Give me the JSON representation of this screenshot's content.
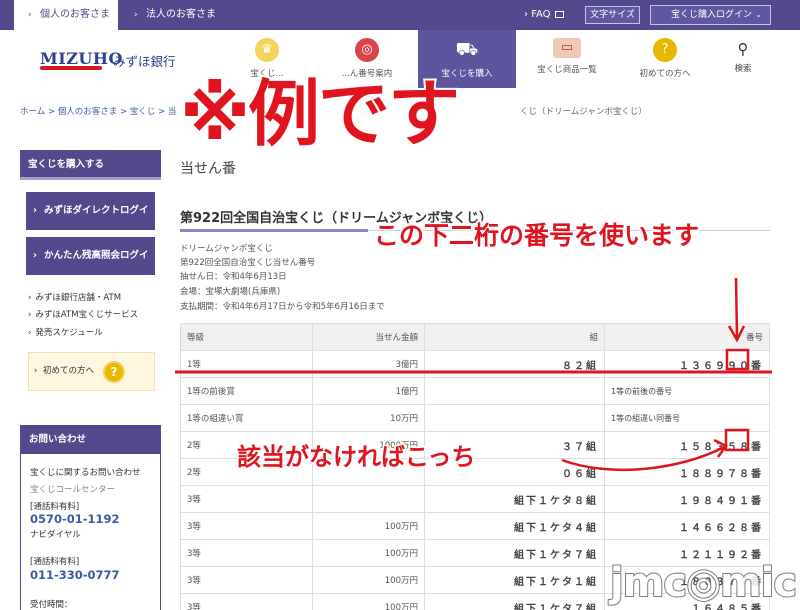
{
  "topbar": {
    "tab_personal": "個人のお客さま",
    "tab_corporate": "法人のお客さま",
    "faq": "FAQ",
    "text_size": "文字サイズ",
    "login": "宝くじ購入ログイン"
  },
  "header": {
    "logo": "MIZUHO",
    "bank_name": "みずほ銀行",
    "nav": [
      {
        "label": "宝くじ..."
      },
      {
        "label": "...ん番号案内"
      },
      {
        "label": "宝くじを購入"
      },
      {
        "label": "宝くじ商品一覧"
      },
      {
        "label": "初めての方へ"
      }
    ],
    "search": "検索"
  },
  "breadcrumb": {
    "left": "ホーム > 個人のお客さま > 宝くじ > 当",
    "right": "くじ（ドリームジャンボ宝くじ）"
  },
  "sidebar": {
    "heading": "宝くじを購入する",
    "btn_direct": "みずほダイレクトログイン",
    "btn_balance": "かんたん残高照会ログイン",
    "links": [
      "みずほ銀行店舗・ATM",
      "みずほATM宝くじサービス",
      "発売スケジュール"
    ],
    "guide": "初めての方へ",
    "contact": {
      "heading": "お問い合わせ",
      "label": "宝くじに関するお問い合わせ",
      "center": "宝くじコールセンター",
      "toll1": "[通話料有料]",
      "phone1": "0570-01-1192",
      "navi": "ナビダイヤル",
      "toll2": "[通話料有料]",
      "phone2": "011-330-0777",
      "hours": "受付時間："
    }
  },
  "main": {
    "page_heading": "当せん番",
    "lottery_title": "第922回全国自治宝くじ（ドリームジャンボ宝くじ）",
    "info": [
      "ドリームジャンボ宝くじ",
      "第922回全国自治宝くじ当せん番号",
      "抽せん日：令和4年6月13日",
      "会場：宝塚大劇場(兵庫県)",
      "支払期間：令和4年6月17日から令和5年6月16日まで"
    ],
    "table": {
      "headers": [
        "等級",
        "当せん金額",
        "組",
        "番号"
      ],
      "rows": [
        {
          "grade": "1等",
          "amount": "3億円",
          "group": "８２組",
          "number": "１３６９９０番"
        },
        {
          "grade": "1等の前後賞",
          "amount": "1億円",
          "group": "",
          "number": "1等の前後の番号"
        },
        {
          "grade": "1等の組違い賞",
          "amount": "10万円",
          "group": "",
          "number": "1等の組違い同番号"
        },
        {
          "grade": "2等",
          "amount": "1000万円",
          "group": "３７組",
          "number": "１５８３５８番"
        },
        {
          "grade": "2等",
          "amount": "",
          "group": "０６組",
          "number": "１８８９７８番"
        },
        {
          "grade": "3等",
          "amount": "",
          "group": "組下１ケタ８組",
          "number": "１９８４９１番"
        },
        {
          "grade": "3等",
          "amount": "100万円",
          "group": "組下１ケタ４組",
          "number": "１４６６２８番"
        },
        {
          "grade": "3等",
          "amount": "100万円",
          "group": "組下１ケタ７組",
          "number": "１２１１９２番"
        },
        {
          "grade": "3等",
          "amount": "100万円",
          "group": "組下１ケタ１組",
          "number": "１８０３７７番"
        },
        {
          "grade": "3等",
          "amount": "100万円",
          "group": "組下１ケタ７組",
          "number": "１６４８５番"
        }
      ]
    }
  },
  "overlay": {
    "example": "※例です",
    "note_last_two": "この下二桁の番号を使います",
    "note_fallback": "該当がなければこっち",
    "watermark": "jmc◎mic"
  },
  "colors": {
    "brand_purple": "#524a8c",
    "annotation_red": "#e0141e",
    "link_blue": "#3d59a8"
  }
}
